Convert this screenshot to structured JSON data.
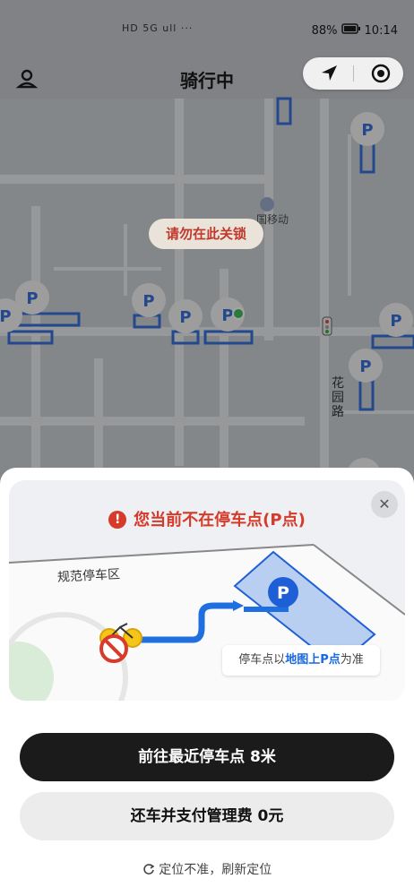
{
  "status_bar": {
    "battery": "88%",
    "time": "10:14",
    "icons": "HD 5G ull ··· "
  },
  "header": {
    "title": "骑行中"
  },
  "map": {
    "tip": "请勿在此关锁",
    "poi_label": "国移动",
    "road_label": "花园路",
    "parking_marker": "P"
  },
  "sheet": {
    "warning": "您当前不在停车点(P点)",
    "close": "✕",
    "area_label": "规范停车区",
    "callout_prefix": "停车点以",
    "callout_highlight": "地图上P点",
    "callout_suffix": "为准",
    "primary_button": "前往最近停车点 8米",
    "secondary_button": "还车并支付管理费 0元",
    "refresh_text": "定位不准，刷新定位"
  }
}
